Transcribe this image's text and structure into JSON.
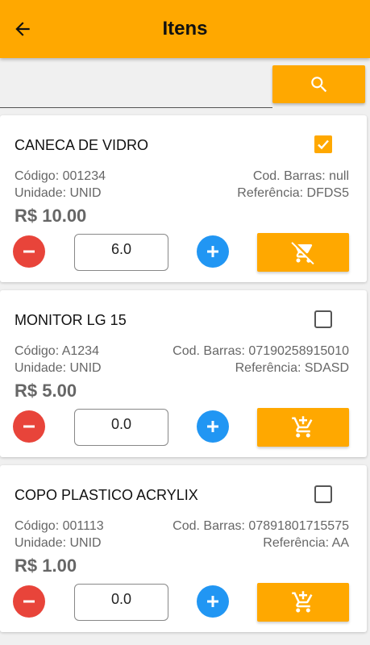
{
  "appbar": {
    "title": "Itens",
    "back_icon": "arrow-back-icon"
  },
  "search": {
    "value": "",
    "placeholder": "",
    "button_icon": "search-icon"
  },
  "colors": {
    "accent": "#FFA800",
    "minus": "#E8443A",
    "plus": "#2196F3"
  },
  "items": [
    {
      "name": "CANECA DE VIDRO",
      "selected": true,
      "codigo": "Código: 001234",
      "barras": "Cod. Barras: null",
      "unidade": "Unidade: UNID",
      "referencia": "Referência: DFDS5",
      "price": "R$ 10.00",
      "quantity": "6.0",
      "cart_icon": "remove-from-cart-icon"
    },
    {
      "name": "MONITOR LG 15",
      "selected": false,
      "codigo": "Código: A1234",
      "barras": "Cod. Barras: 07190258915010",
      "unidade": "Unidade: UNID",
      "referencia": "Referência: SDASD",
      "price": "R$ 5.00",
      "quantity": "0.0",
      "cart_icon": "add-to-cart-icon"
    },
    {
      "name": "COPO PLASTICO ACRYLIX",
      "selected": false,
      "codigo": "Código: 001113",
      "barras": "Cod. Barras: 07891801715575",
      "unidade": "Unidade: UNID",
      "referencia": "Referência: AA",
      "price": "R$ 1.00",
      "quantity": "0.0",
      "cart_icon": "add-to-cart-icon"
    }
  ]
}
